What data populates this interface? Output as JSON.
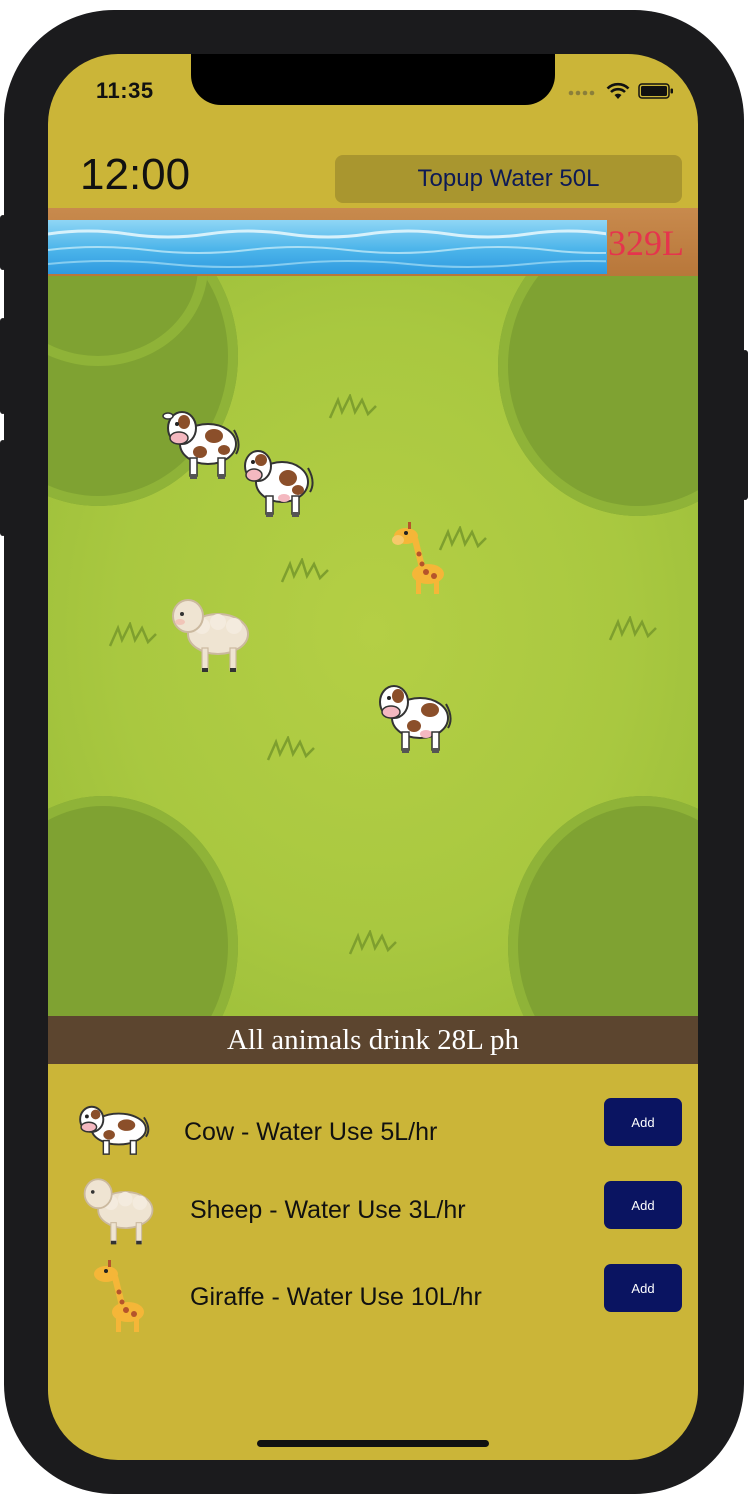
{
  "status_bar": {
    "time": "11:35",
    "signal_icon": "signal-dots-icon",
    "wifi_icon": "wifi-icon",
    "battery_icon": "battery-icon"
  },
  "header": {
    "clock": "12:00",
    "topup_label": "Topup Water 50L"
  },
  "water": {
    "level_label": "329L",
    "fill_fraction": 0.86
  },
  "field_animals": [
    {
      "type": "cow",
      "icon": "cow-icon"
    },
    {
      "type": "cow",
      "icon": "cow-icon"
    },
    {
      "type": "giraffe",
      "icon": "giraffe-icon"
    },
    {
      "type": "sheep",
      "icon": "sheep-icon"
    },
    {
      "type": "cow",
      "icon": "cow-icon"
    }
  ],
  "summary": {
    "text": "All animals drink 28L ph"
  },
  "animal_list": [
    {
      "icon": "cow-icon",
      "label": "Cow - Water Use 5L/hr",
      "button": "Add"
    },
    {
      "icon": "sheep-icon",
      "label": "Sheep - Water Use 3L/hr",
      "button": "Add"
    },
    {
      "icon": "giraffe-icon",
      "label": "Giraffe - Water Use 10L/hr",
      "button": "Add"
    }
  ],
  "colors": {
    "screen_bg": "#cbb538",
    "topup_button": "#a9962f",
    "add_button": "#0a1461",
    "summary_bar": "#5c452f",
    "water_level_text": "#e5344d",
    "field": "#a9c840"
  }
}
